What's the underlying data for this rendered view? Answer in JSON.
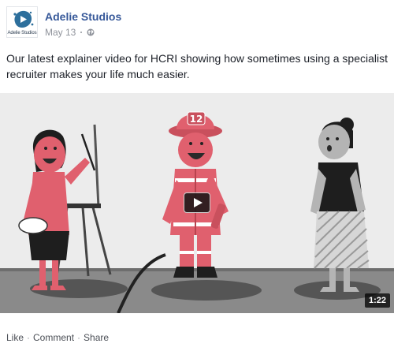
{
  "post": {
    "avatar_logo_text": "Adelie Studios",
    "page_name": "Adelie Studios",
    "date": "May 13",
    "privacy_icon": "globe-icon",
    "text": "Our latest explainer video for HCRI showing how sometimes using a specialist recruiter makes your life much easier.",
    "video": {
      "duration": "1:22",
      "helmet_number": "12",
      "play_icon": "play-icon"
    },
    "actions": {
      "like": "Like",
      "comment": "Comment",
      "share": "Share",
      "separator": "·"
    },
    "colors": {
      "page_name": "#365899",
      "meta": "#90949c",
      "accent_pink": "#e0606e",
      "video_bg": "#ececec"
    }
  }
}
